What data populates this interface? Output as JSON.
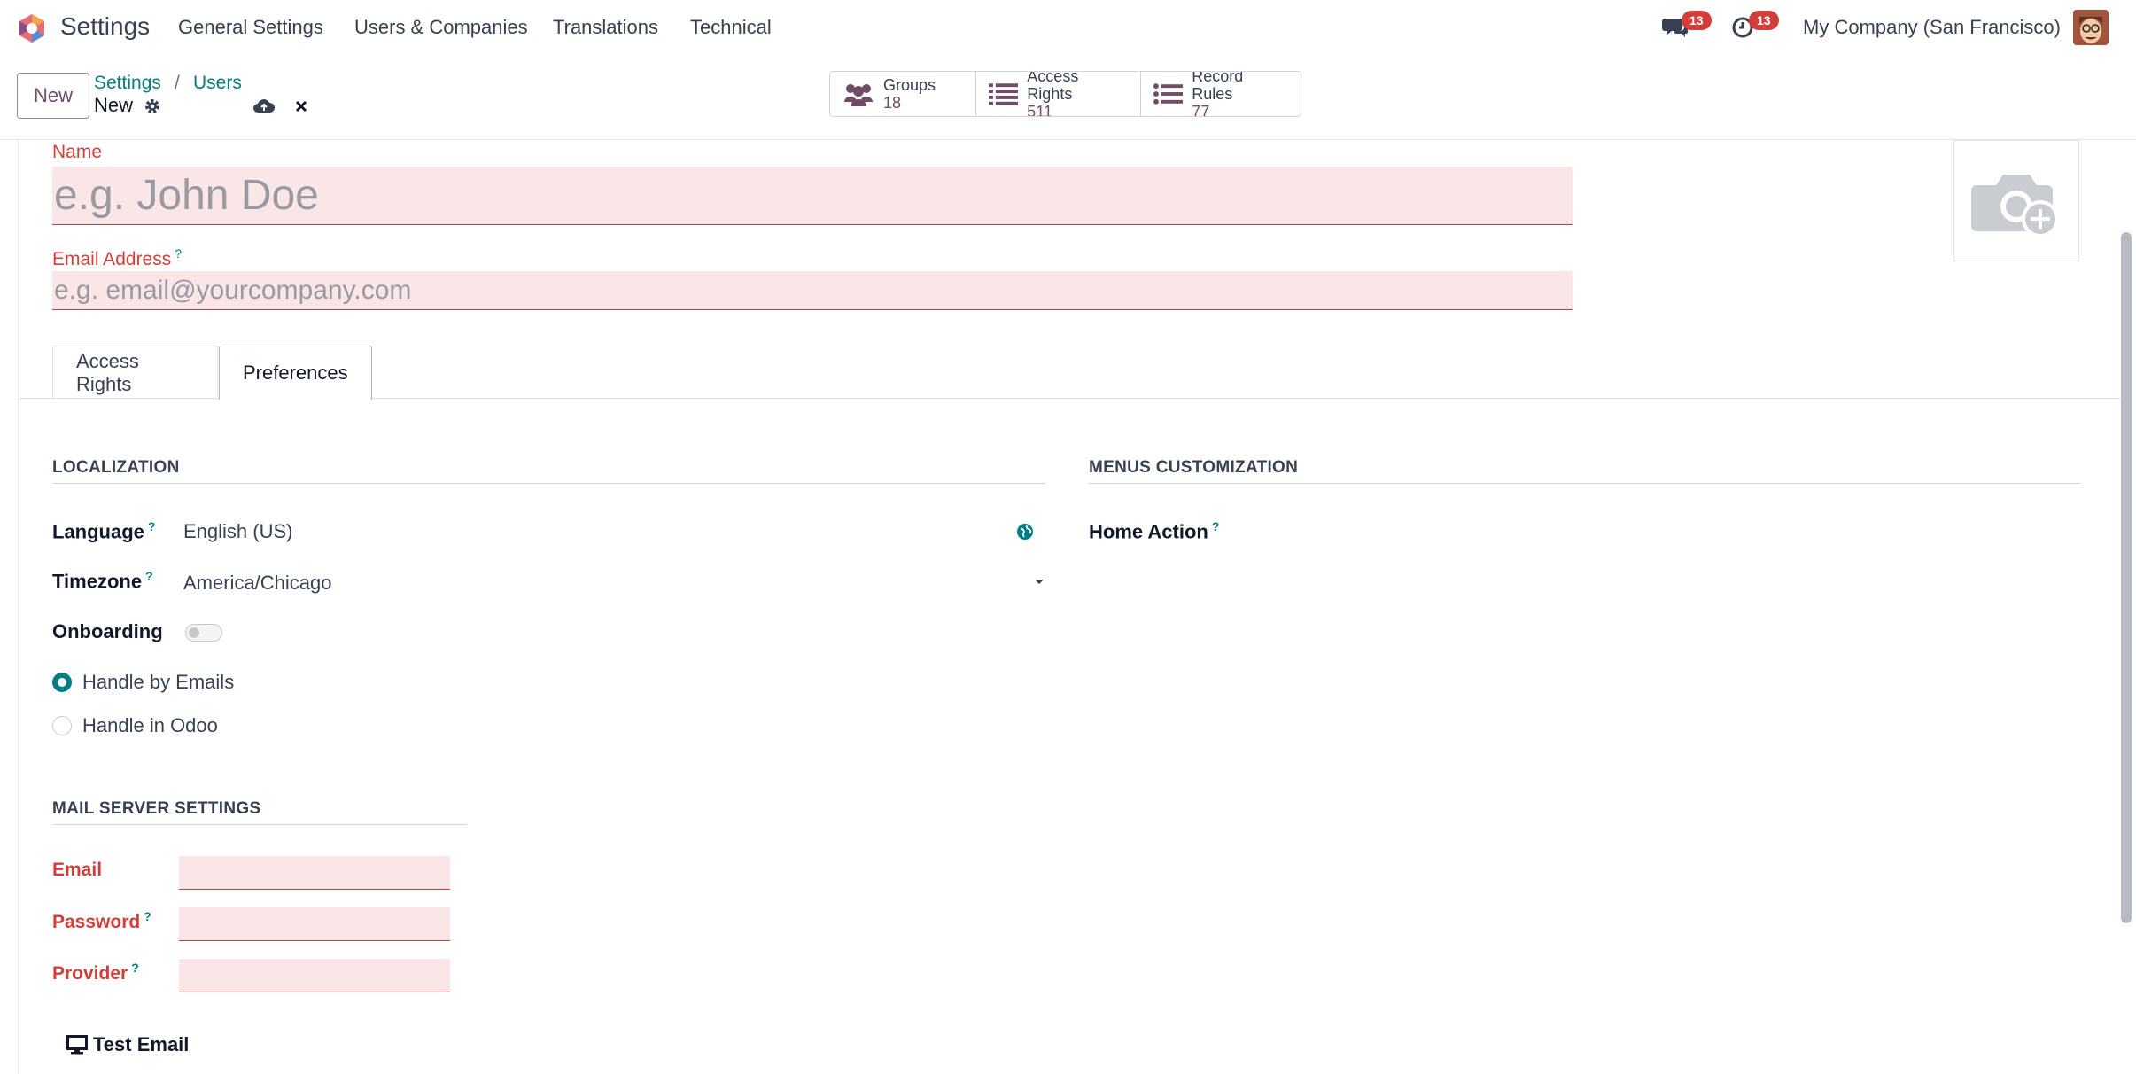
{
  "colors": {
    "brand": "#714b67",
    "accent": "#017e84",
    "required": "#d23f3a",
    "required_bg": "#fbe6e7"
  },
  "topnav": {
    "app_title": "Settings",
    "menu": [
      "General Settings",
      "Users & Companies",
      "Translations",
      "Technical"
    ],
    "messages_badge": "13",
    "activities_badge": "13",
    "company": "My Company (San Francisco)"
  },
  "control": {
    "new_label": "New",
    "breadcrumbs": [
      "Settings",
      "Users"
    ],
    "breadcrumb_sep": "/",
    "current_record": "New",
    "stats": [
      {
        "label": "Groups",
        "value": "18",
        "icon": "users-icon"
      },
      {
        "label": "Access Rights",
        "value": "511",
        "icon": "list-icon"
      },
      {
        "label": "Record Rules",
        "value": "77",
        "icon": "list-ul-icon"
      }
    ]
  },
  "form": {
    "name_label": "Name",
    "name_placeholder": "e.g. John Doe",
    "email_label": "Email Address",
    "email_placeholder": "e.g. email@yourcompany.com",
    "help_mark": "?",
    "tabs": [
      "Access Rights",
      "Preferences"
    ],
    "active_tab": "Preferences",
    "localization": {
      "title": "LOCALIZATION",
      "language_label": "Language",
      "language_value": "English (US)",
      "timezone_label": "Timezone",
      "timezone_value": "America/Chicago",
      "onboarding_label": "Onboarding",
      "onboarding_on": false,
      "notification_options": [
        "Handle by Emails",
        "Handle in Odoo"
      ],
      "notification_selected": "Handle by Emails"
    },
    "menus": {
      "title": "MENUS CUSTOMIZATION",
      "home_action_label": "Home Action"
    },
    "mail_server": {
      "title": "MAIL SERVER SETTINGS",
      "email_label": "Email",
      "password_label": "Password",
      "provider_label": "Provider",
      "test_label": "Test Email"
    }
  }
}
